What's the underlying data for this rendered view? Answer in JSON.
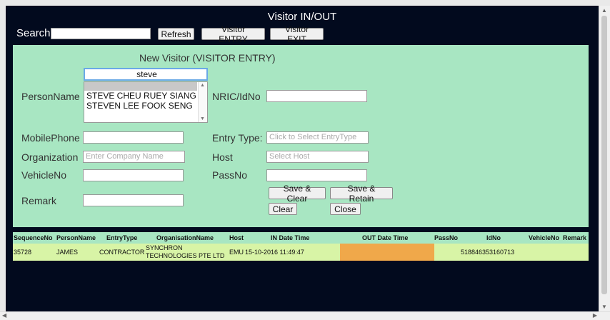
{
  "header": {
    "title": "Visitor IN/OUT"
  },
  "search": {
    "label": "Search:",
    "value": ""
  },
  "toolbar": {
    "refresh": "Refresh",
    "entry": "Visitor ENTRY",
    "exit": "Visitor EXIT"
  },
  "form": {
    "title": "New Visitor (VISITOR ENTRY)",
    "person_name_label": "PersonName",
    "person_search_value": "steve",
    "person_suggestions": [
      "STEVE CHEU RUEY SIANG",
      "STEVEN LEE FOOK SENG"
    ],
    "nric_label": "NRIC/IdNo",
    "mobile_label": "MobilePhone",
    "entry_type_label": "Entry Type:",
    "entry_type_placeholder": "Click to Select EntryType",
    "organization_label": "Organization",
    "organization_placeholder": "Enter Company Name",
    "host_label": "Host",
    "host_placeholder": "Select Host",
    "vehicle_label": "VehicleNo",
    "pass_label": "PassNo",
    "remark_label": "Remark",
    "save_clear": "Save & Clear",
    "save_retain": "Save & Retain",
    "clear": "Clear",
    "close": "Close"
  },
  "table": {
    "columns": [
      "SequenceNo",
      "PersonName",
      "EntryType",
      "OrganisationName",
      "Host",
      "IN Date Time",
      "OUT Date Time",
      "PassNo",
      "IdNo",
      "VehicleNo",
      "Remark"
    ],
    "rows": [
      {
        "seq": "35728",
        "person": "JAMES",
        "entry_type": "CONTRACTOR",
        "org_line1": "SYNCHRON",
        "org_line2": "TECHNOLOGIES PTE LTD",
        "host": "EMU",
        "in_time": "15-10-2016 11:49:47",
        "out_time": "",
        "pass": "",
        "id": "518846353160713",
        "vehicle": "",
        "remark": ""
      }
    ]
  },
  "colors": {
    "frame_bg": "#020a1e",
    "panel_bg": "#a8e6c2",
    "row_bg": "#d8f4a6",
    "out_highlight": "#f0a84a"
  }
}
